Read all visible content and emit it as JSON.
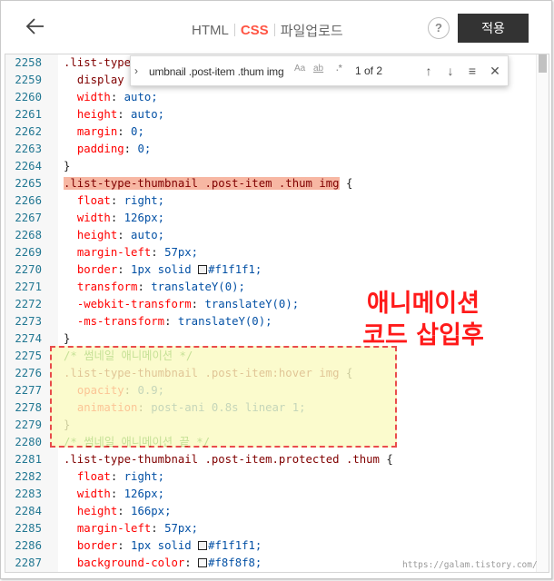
{
  "header": {
    "back_icon": "arrow-left-icon",
    "tabs": [
      {
        "label": "HTML",
        "active": false
      },
      {
        "label": "CSS",
        "active": true
      },
      {
        "label": "파일업로드",
        "active": false
      }
    ],
    "help_label": "?",
    "apply_label": "적용"
  },
  "find_widget": {
    "query": "umbnail .post-item .thum img",
    "match_case": "Aa",
    "whole_word": "ab",
    "regex": ".*",
    "count": "1 of 2",
    "prev_icon": "arrow-up-icon",
    "next_icon": "arrow-down-icon",
    "selection_icon": "find-in-selection-icon",
    "close_icon": "close-icon"
  },
  "editor": {
    "lines": [
      {
        "n": "2258",
        "text": "  .list-type"
      },
      {
        "n": "2259",
        "text": "    display"
      },
      {
        "n": "2260",
        "text": "    width: auto;"
      },
      {
        "n": "2261",
        "text": "    height: auto;"
      },
      {
        "n": "2262",
        "text": "    margin: 0;"
      },
      {
        "n": "2263",
        "text": "    padding: 0;"
      },
      {
        "n": "2264",
        "text": "  }"
      },
      {
        "n": "2265",
        "text": "  .list-type-thumbnail .post-item .thum img {"
      },
      {
        "n": "2266",
        "text": "    float: right;"
      },
      {
        "n": "2267",
        "text": "    width: 126px;"
      },
      {
        "n": "2268",
        "text": "    height: auto;"
      },
      {
        "n": "2269",
        "text": "    margin-left: 57px;"
      },
      {
        "n": "2270",
        "text": "    border: 1px solid #f1f1f1;"
      },
      {
        "n": "2271",
        "text": "    transform: translateY(0);"
      },
      {
        "n": "2272",
        "text": "    -webkit-transform: translateY(0);"
      },
      {
        "n": "2273",
        "text": "    -ms-transform: translateY(0);"
      },
      {
        "n": "2274",
        "text": "  }"
      },
      {
        "n": "2275",
        "text": "  /* 썸네일 애니메이션 */"
      },
      {
        "n": "2276",
        "text": "  .list-type-thumbnail .post-item:hover img {"
      },
      {
        "n": "2277",
        "text": "    opacity: 0.9;"
      },
      {
        "n": "2278",
        "text": "    animation: post-ani 0.8s linear 1;"
      },
      {
        "n": "2279",
        "text": "  }"
      },
      {
        "n": "2280",
        "text": "  /* 썸네일 애니메이션 끝 */"
      },
      {
        "n": "2281",
        "text": "  .list-type-thumbnail .post-item.protected .thum {"
      },
      {
        "n": "2282",
        "text": "    float: right;"
      },
      {
        "n": "2283",
        "text": "    width: 126px;"
      },
      {
        "n": "2284",
        "text": "    height: 166px;"
      },
      {
        "n": "2285",
        "text": "    margin-left: 57px;"
      },
      {
        "n": "2286",
        "text": "    border: 1px solid #f1f1f1;"
      },
      {
        "n": "2287",
        "text": "    background-color: #f8f8f8;"
      }
    ]
  },
  "annotation": {
    "line1": "애니메이션",
    "line2": "코드 삽입후",
    "color": "#ff1a1a"
  },
  "watermark": "https://galam.tistory.com/"
}
